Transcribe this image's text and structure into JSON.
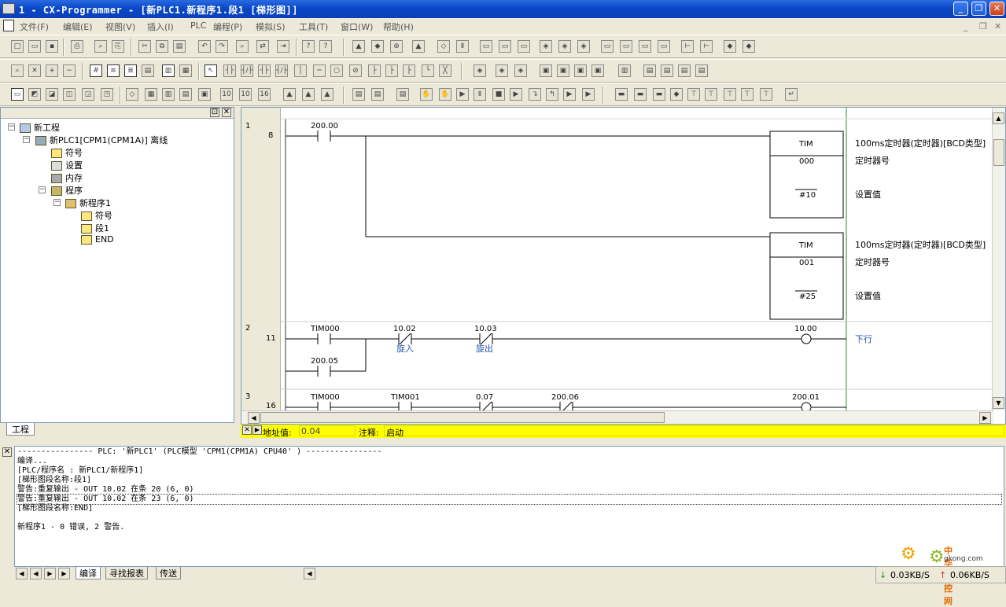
{
  "window": {
    "title": "1 - CX-Programmer - [新PLC1.新程序1.段1 [梯形图]]"
  },
  "menu": [
    "文件(F)",
    "编辑(E)",
    "视图(V)",
    "插入(I)",
    "PLC",
    "编程(P)",
    "模拟(S)",
    "工具(T)",
    "窗口(W)",
    "帮助(H)"
  ],
  "tree": {
    "root": "新工程",
    "plc": "新PLC1[CPM1(CPM1A)] 离线",
    "symbols": "符号",
    "settings": "设置",
    "memory": "内存",
    "programs": "程序",
    "program1": "新程序1",
    "prog_symbols": "符号",
    "section1": "段1",
    "end": "END",
    "tab": "工程"
  },
  "ladder": {
    "rungs": [
      {
        "num": "1",
        "step": "8"
      },
      {
        "num": "2",
        "step": "11"
      },
      {
        "num": "3",
        "step": "16"
      }
    ],
    "r1_contact": "200.00",
    "tim1": {
      "name": "TIM",
      "num": "000",
      "set": "#10",
      "desc": "100ms定时器(定时器)[BCD类型]",
      "num_label": "定时器号",
      "set_label": "设置值"
    },
    "tim2": {
      "name": "TIM",
      "num": "001",
      "set": "#25",
      "desc": "100ms定时器(定时器)[BCD类型]",
      "num_label": "定时器号",
      "set_label": "设置值"
    },
    "r2": {
      "c1": "TIM000",
      "c2": "10.02",
      "c2_cmt": "旋入",
      "c3": "10.03",
      "c3_cmt": "旋出",
      "c4": "200.05",
      "coil": "10.00",
      "coil_cmt": "下行"
    },
    "r3": {
      "c1": "TIM000",
      "c2": "TIM001",
      "c3": "0.07",
      "c4": "200.06",
      "coil": "200.01"
    }
  },
  "addr": {
    "addr_label": "地址值:",
    "addr_value": "0.04",
    "cmt_label": "注释:",
    "cmt_value": "启动"
  },
  "output": {
    "lines": [
      "---------------- PLC: '新PLC1' (PLC模型 'CPM1(CPM1A) CPU40' ) ----------------",
      "编译...",
      "[PLC/程序名 : 新PLC1/新程序1]",
      "[梯形图段名称:段1]",
      "警告:重复输出 - OUT 10.02 在条 20 (6, 0)",
      "警告:重复输出 - OUT 10.02 在条 23 (6, 0)",
      "[梯形图段名称:END]",
      "",
      "新程序1 - 0 错误, 2 警告."
    ],
    "tabs": [
      "编译",
      "寻找报表",
      "传送"
    ]
  },
  "status": {
    "down": "0.03KB/S",
    "up": "0.06KB/S"
  },
  "watermark": {
    "name": "中华工控网",
    "url": "gkong.com"
  }
}
